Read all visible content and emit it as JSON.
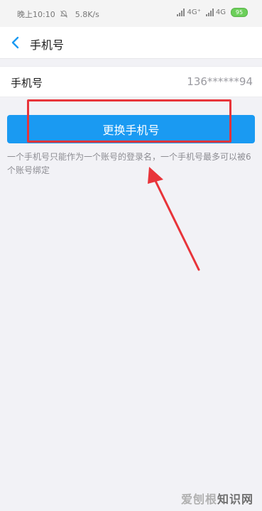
{
  "status_bar": {
    "time": "晚上10:10",
    "speed": "5.8K/s",
    "net1": "4G⁺",
    "net2": "4G",
    "battery": "95"
  },
  "nav": {
    "title": "手机号"
  },
  "phone_row": {
    "label": "手机号",
    "value": "136******94"
  },
  "actions": {
    "change_label": "更换手机号"
  },
  "hint": "一个手机号只能作为一个账号的登录名，一个手机号最多可以被6个账号绑定",
  "watermark": {
    "part1": "爱刨根",
    "part2": "知识网"
  },
  "colors": {
    "primary": "#1a9af2",
    "annotation": "#e8343a",
    "background": "#f2f2f6"
  }
}
